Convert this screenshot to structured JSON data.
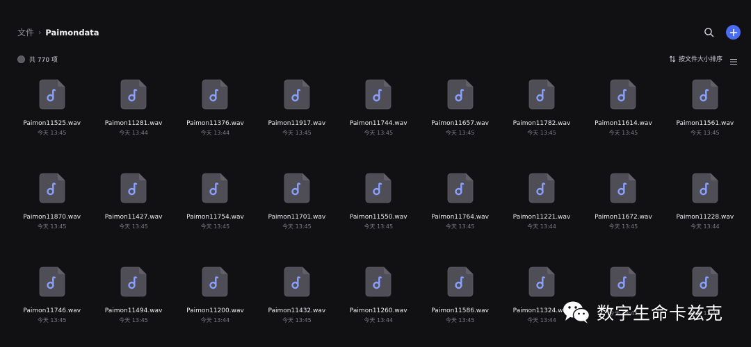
{
  "breadcrumb": {
    "root": "文件",
    "separator": "›",
    "current": "Paimondata"
  },
  "header": {
    "search_icon": "search-icon",
    "add_icon": "plus-icon"
  },
  "toolbar": {
    "count_label": "共 770 项",
    "sort_label": "按文件大小排序"
  },
  "colors": {
    "accent": "#4a6cf0",
    "file_icon_bg": "#4f4d55",
    "music_note": "#8aa0ff",
    "background": "#111114"
  },
  "files": [
    {
      "name": "Paimon11525.wav",
      "time": "今天 13:45"
    },
    {
      "name": "Paimon11281.wav",
      "time": "今天 13:44"
    },
    {
      "name": "Paimon11376.wav",
      "time": "今天 13:44"
    },
    {
      "name": "Paimon11917.wav",
      "time": "今天 13:45"
    },
    {
      "name": "Paimon11744.wav",
      "time": "今天 13:45"
    },
    {
      "name": "Paimon11657.wav",
      "time": "今天 13:45"
    },
    {
      "name": "Paimon11782.wav",
      "time": "今天 13:45"
    },
    {
      "name": "Paimon11614.wav",
      "time": "今天 13:45"
    },
    {
      "name": "Paimon11561.wav",
      "time": "今天 13:45"
    },
    {
      "name": "Paimon11870.wav",
      "time": "今天 13:45"
    },
    {
      "name": "Paimon11427.wav",
      "time": "今天 13:45"
    },
    {
      "name": "Paimon11754.wav",
      "time": "今天 13:45"
    },
    {
      "name": "Paimon11701.wav",
      "time": "今天 13:45"
    },
    {
      "name": "Paimon11550.wav",
      "time": "今天 13:45"
    },
    {
      "name": "Paimon11764.wav",
      "time": "今天 13:45"
    },
    {
      "name": "Paimon11221.wav",
      "time": "今天 13:44"
    },
    {
      "name": "Paimon11672.wav",
      "time": "今天 13:45"
    },
    {
      "name": "Paimon11228.wav",
      "time": "今天 13:44"
    },
    {
      "name": "Paimon11746.wav",
      "time": "今天 13:45"
    },
    {
      "name": "Paimon11494.wav",
      "time": "今天 13:45"
    },
    {
      "name": "Paimon11200.wav",
      "time": "今天 13:44"
    },
    {
      "name": "Paimon11432.wav",
      "time": "今天 13:45"
    },
    {
      "name": "Paimon11260.wav",
      "time": "今天 13:44"
    },
    {
      "name": "Paimon11586.wav",
      "time": "今天 13:45"
    },
    {
      "name": "Paimon11324.wav",
      "time": "今天 13:44"
    },
    {
      "name": "",
      "time": "今天 13:45"
    },
    {
      "name": "",
      "time": "今天 13:45"
    }
  ],
  "watermark": {
    "text": "数字生命卡兹克",
    "icon": "wechat-icon"
  }
}
